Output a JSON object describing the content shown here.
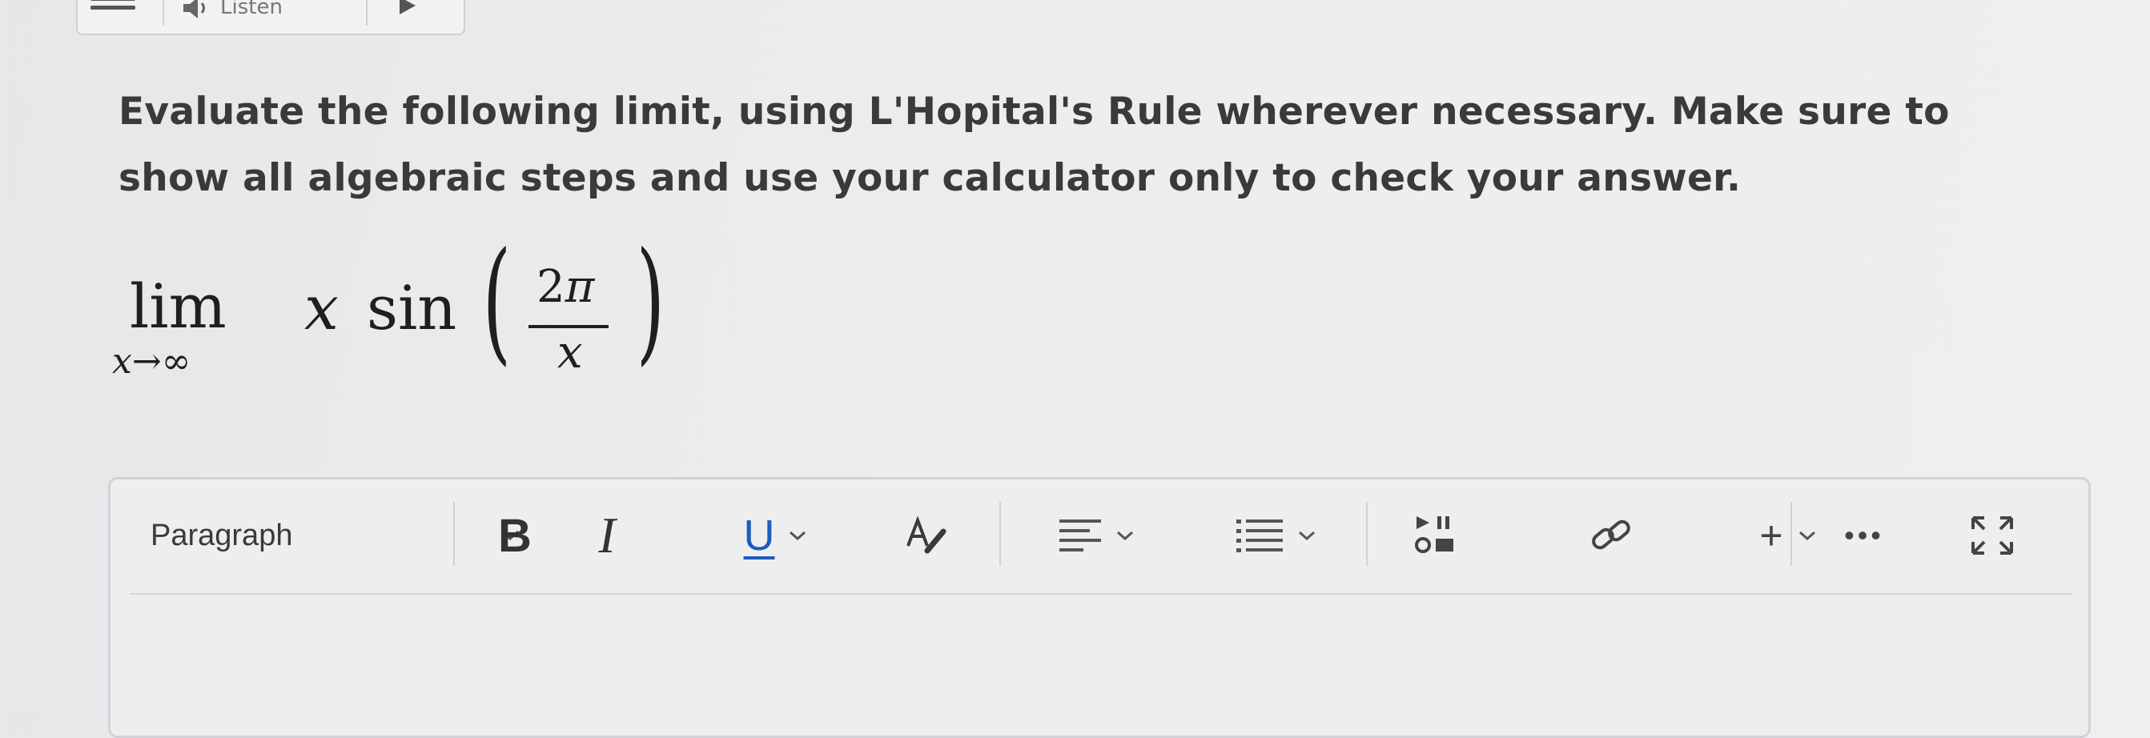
{
  "topbar": {
    "listen_label": "Listen"
  },
  "question": {
    "text": "Evaluate the following limit, using L'Hopital's Rule wherever necessary. Make sure to show all algebraic steps and use your calculator only to check your answer."
  },
  "math": {
    "lim": "lim",
    "sub_var": "x",
    "sub_arrow": "→",
    "sub_inf": "∞",
    "var": "x",
    "func": "sin",
    "num_coef": "2",
    "num_pi": "π",
    "den": "x",
    "paren_left": "(",
    "paren_right": ")"
  },
  "editor": {
    "block_format": "Paragraph",
    "bold_label": "B",
    "italic_label": "I",
    "underline_label": "U",
    "insert_label": "+",
    "more_label": "•••"
  },
  "colors": {
    "underline_accent": "#1e5bbf",
    "text": "#3a3a3a",
    "background": "#eceef0"
  }
}
